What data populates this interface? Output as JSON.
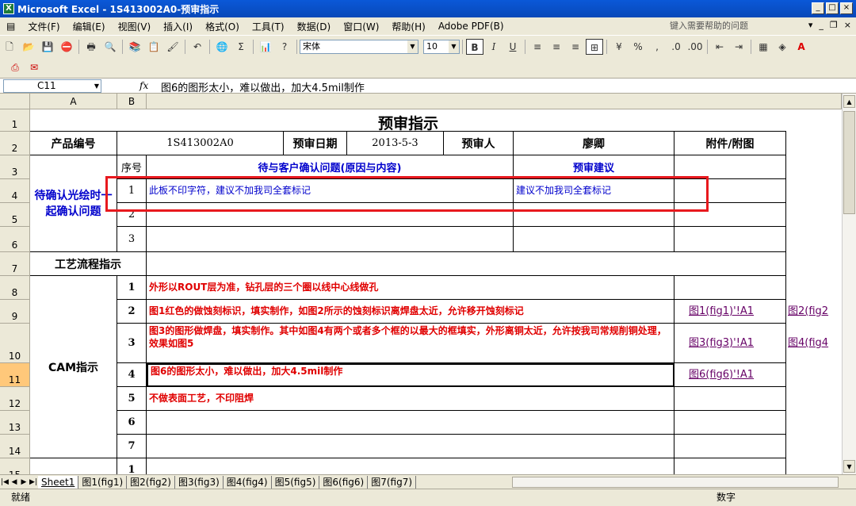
{
  "window": {
    "title": "Microsoft Excel - 1S413002A0-预审指示",
    "app_icon": "X"
  },
  "menus": [
    "文件(F)",
    "编辑(E)",
    "视图(V)",
    "插入(I)",
    "格式(O)",
    "工具(T)",
    "数据(D)",
    "窗口(W)",
    "帮助(H)",
    "Adobe PDF(B)"
  ],
  "help_box": "键入需要帮助的问题",
  "font": {
    "name": "宋体",
    "size": "10"
  },
  "name_box": "C11",
  "formula": "图6的图形太小，难以做出，加大4.5mil制作",
  "col_headers": [
    "A",
    "B"
  ],
  "row_headers": [
    "1",
    "2",
    "3",
    "4",
    "5",
    "6",
    "7",
    "8",
    "9",
    "10",
    "11",
    "12",
    "13",
    "14",
    "15"
  ],
  "sheet": {
    "title": "预审指示",
    "product_no_label": "产品编号",
    "product_no": "1S413002A0",
    "review_date_label": "预审日期",
    "review_date": "2013-5-3",
    "reviewer_label": "预审人",
    "reviewer": "廖卿",
    "attach_label": "附件/附图",
    "pending_label": "待确认光绘时一起确认问题",
    "seq_label": "序号",
    "issue_label": "待与客户确认问题(原因与内容)",
    "suggest_label": "预审建议",
    "pending_rows": [
      {
        "no": "1",
        "issue": "此板不印字符，建议不加我司全套标记",
        "suggest": "建议不加我司全套标记"
      },
      {
        "no": "2",
        "issue": "",
        "suggest": ""
      },
      {
        "no": "3",
        "issue": "",
        "suggest": ""
      }
    ],
    "process_label": "工艺流程指示",
    "cam_label": "CAM指示",
    "cam_rows": [
      {
        "no": "1",
        "text": "外形以ROUT层为准，钻孔层的三个圈以线中心线做孔",
        "link1": "",
        "link2": ""
      },
      {
        "no": "2",
        "text": "图1红色的做蚀刻标识，填实制作，如图2所示的蚀刻标识离焊盘太近，允许移开蚀刻标记",
        "link1": "图1(fig1)'!A1",
        "link2": "图2(fig2"
      },
      {
        "no": "3",
        "text": "图3的图形做焊盘，填实制作。其中如图4有两个或者多个框的以最大的框填实，外形离铜太近，允许按我司常规削铜处理，效果如图5",
        "link1": "图3(fig3)'!A1",
        "link2": "图4(fig4"
      },
      {
        "no": "4",
        "text": "图6的图形太小，难以做出，加大4.5mil制作",
        "link1": "图6(fig6)'!A1",
        "link2": ""
      },
      {
        "no": "5",
        "text": "不做表面工艺，不印阻焊",
        "link1": "",
        "link2": ""
      },
      {
        "no": "6",
        "text": "",
        "link1": "",
        "link2": ""
      },
      {
        "no": "7",
        "text": "",
        "link1": "",
        "link2": ""
      }
    ],
    "last_no": "1"
  },
  "tabs": [
    "Sheet1",
    "图1(fig1)",
    "图2(fig2)",
    "图3(fig3)",
    "图4(fig4)",
    "图5(fig5)",
    "图6(fig6)",
    "图7(fig7)"
  ],
  "status": {
    "left": "就绪",
    "right": "数字"
  }
}
